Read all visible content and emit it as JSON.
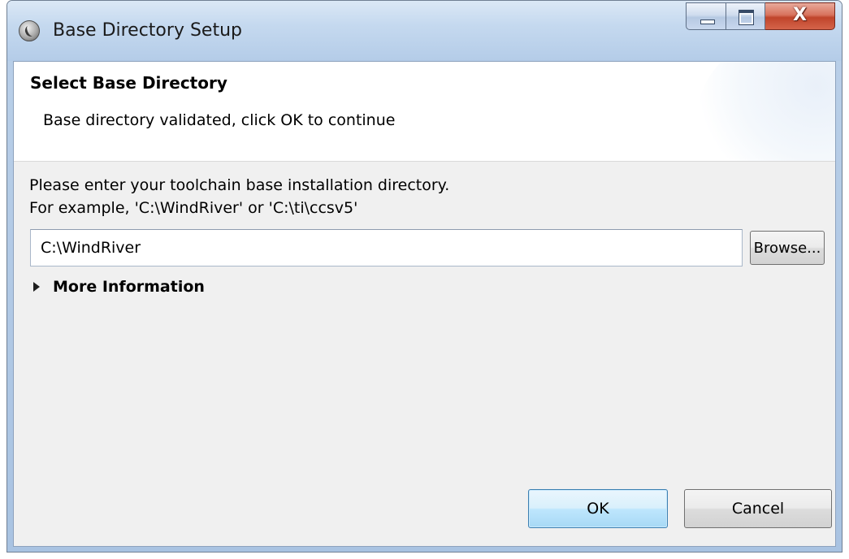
{
  "window": {
    "title": "Base Directory Setup",
    "app_icon": "eclipse-app-icon",
    "controls": {
      "minimize_icon": "minimize-icon",
      "maximize_icon": "maximize-icon",
      "close_glyph": "X"
    }
  },
  "header": {
    "title": "Select Base Directory",
    "message": "Base directory validated, click OK to continue"
  },
  "body": {
    "instruction_line1": "Please enter your toolchain base installation directory.",
    "instruction_line2": "For example, 'C:\\WindRiver' or 'C:\\ti\\ccsv5'",
    "path_value": "C:\\WindRiver",
    "browse_label": "Browse...",
    "more_info_label": "More Information",
    "more_info_icon": "expand-triangle-icon"
  },
  "footer": {
    "ok_label": "OK",
    "cancel_label": "Cancel"
  },
  "colors": {
    "title_bar": "#c5d9ef",
    "client_bg": "#f0f0f0",
    "close_button": "#c0452b",
    "default_button": "#bee6fd"
  }
}
